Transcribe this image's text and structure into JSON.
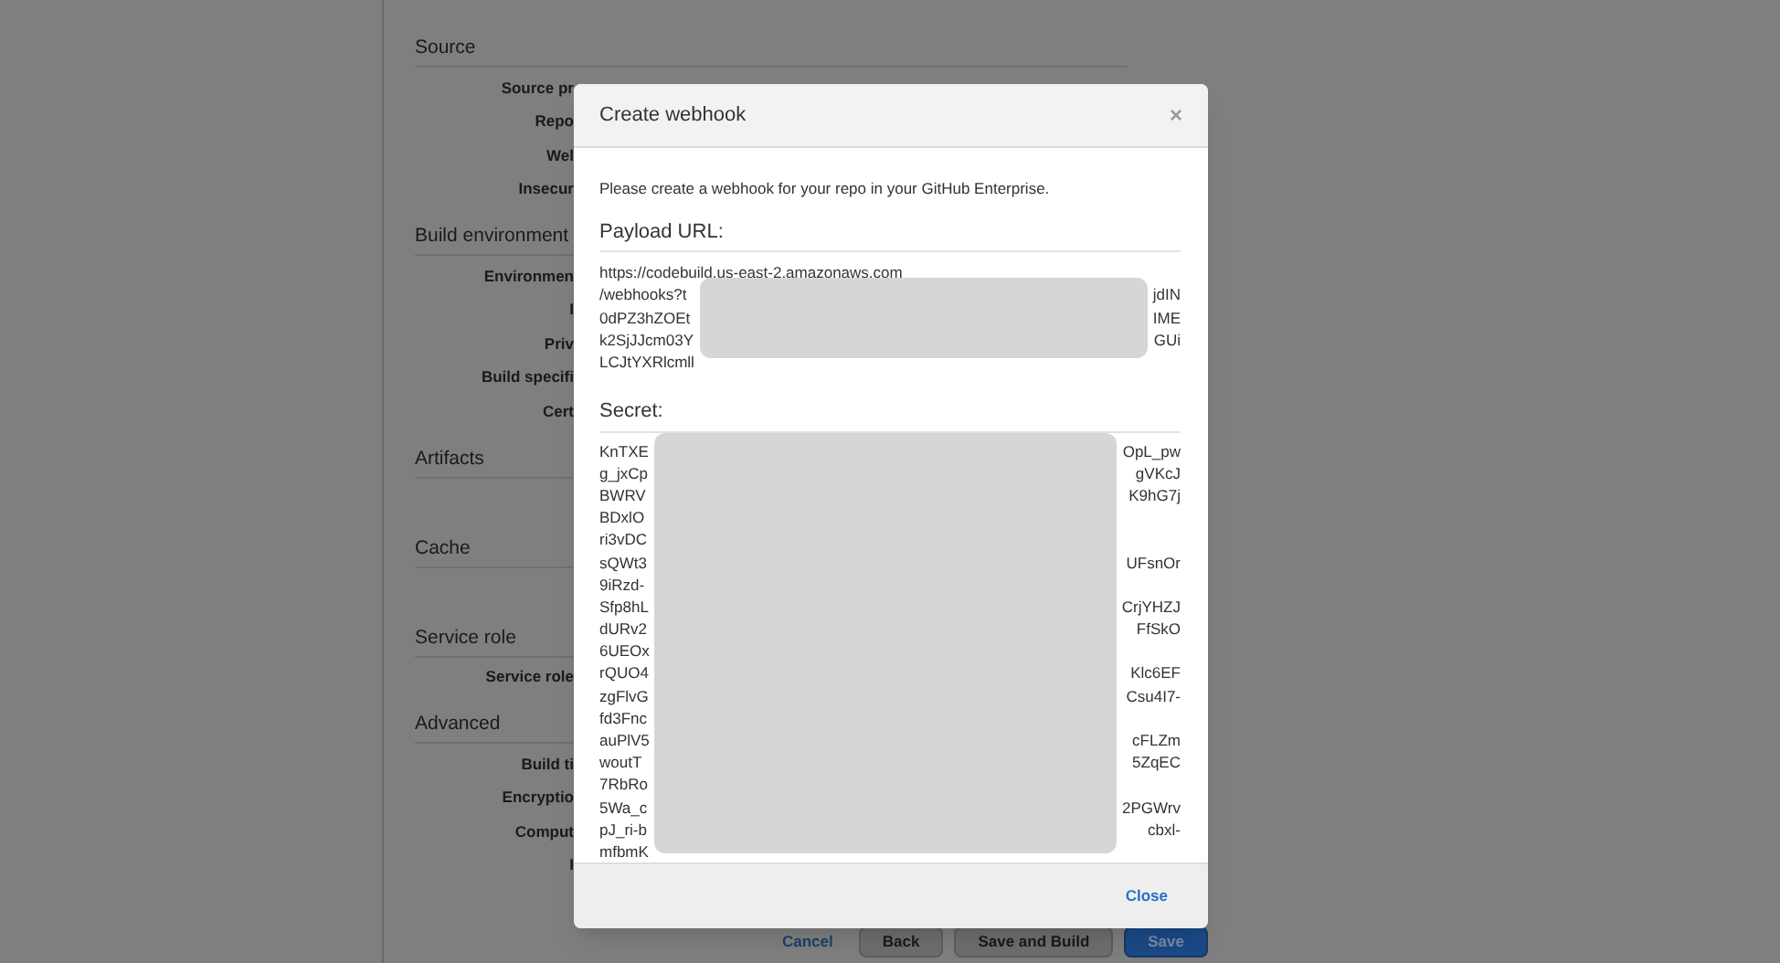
{
  "background_form": {
    "sections": [
      {
        "title": "Source",
        "fields": [
          "Source pr",
          "Repo",
          "Wel",
          "Insecur"
        ]
      },
      {
        "title": "Build environment",
        "fields": [
          "Environmen",
          "I",
          "Priv",
          "Build specifi",
          "Cert"
        ]
      },
      {
        "title": "Artifacts"
      },
      {
        "title": "Cache"
      },
      {
        "title": "Service role",
        "fields": [
          "Service role"
        ]
      },
      {
        "title": "Advanced",
        "fields": [
          "Build ti",
          "Encryptio",
          "Comput",
          "I"
        ]
      }
    ],
    "buttons": [
      {
        "label": "Cancel",
        "kind": "link"
      },
      {
        "label": "Back",
        "kind": "secondary"
      },
      {
        "label": "Save and Build",
        "kind": "secondary"
      },
      {
        "label": "Save",
        "kind": "primary"
      }
    ]
  },
  "dialog": {
    "title": "Create webhook",
    "close_icon": "×",
    "intro": "Please create a webhook for your repo in your GitHub Enterprise.",
    "payload_url": {
      "label": "Payload URL:",
      "first_line": "https://codebuild.us-east-2.amazonaws.com",
      "lines": [
        {
          "start": "/webhooks?t",
          "end": "jdIN"
        },
        {
          "start": "0dPZ3hZOEt",
          "end": "IME"
        },
        {
          "start": "k2SjJJcm03Y",
          "end": "GUi"
        },
        {
          "start": "LCJtYXRlcmll"
        }
      ]
    },
    "secret": {
      "label": "Secret:",
      "lines": [
        {
          "start": "KnTXE",
          "end": "OpL_pw"
        },
        {
          "start": "g_jxCp",
          "end": "gVKcJ"
        },
        {
          "start": "BWRV",
          "end": "K9hG7j"
        },
        {
          "start": "BDxlO"
        },
        {
          "start": "ri3vDC"
        },
        {
          "start": "sQWt3",
          "end": "UFsnOr"
        },
        {
          "start": "9iRzd-"
        },
        {
          "start": "Sfp8hL",
          "end": "CrjYHZJ"
        },
        {
          "start": "dURv2",
          "end": "FfSkO"
        },
        {
          "start": "6UEOx"
        },
        {
          "start": "rQUO4",
          "end": "Klc6EF"
        },
        {
          "start": "zgFlvG",
          "end": "Csu4I7-"
        },
        {
          "start": "fd3Fnc"
        },
        {
          "start": "auPlV5",
          "end": "cFLZm"
        },
        {
          "start": "woutT",
          "end": "5ZqEC"
        },
        {
          "start": "7RbRo"
        },
        {
          "start": "5Wa_c",
          "end": "2PGWrv"
        },
        {
          "start": "pJ_ri-b",
          "end": "cbxl-"
        },
        {
          "start": "mfbmK"
        }
      ]
    },
    "footer_button": "Close"
  }
}
